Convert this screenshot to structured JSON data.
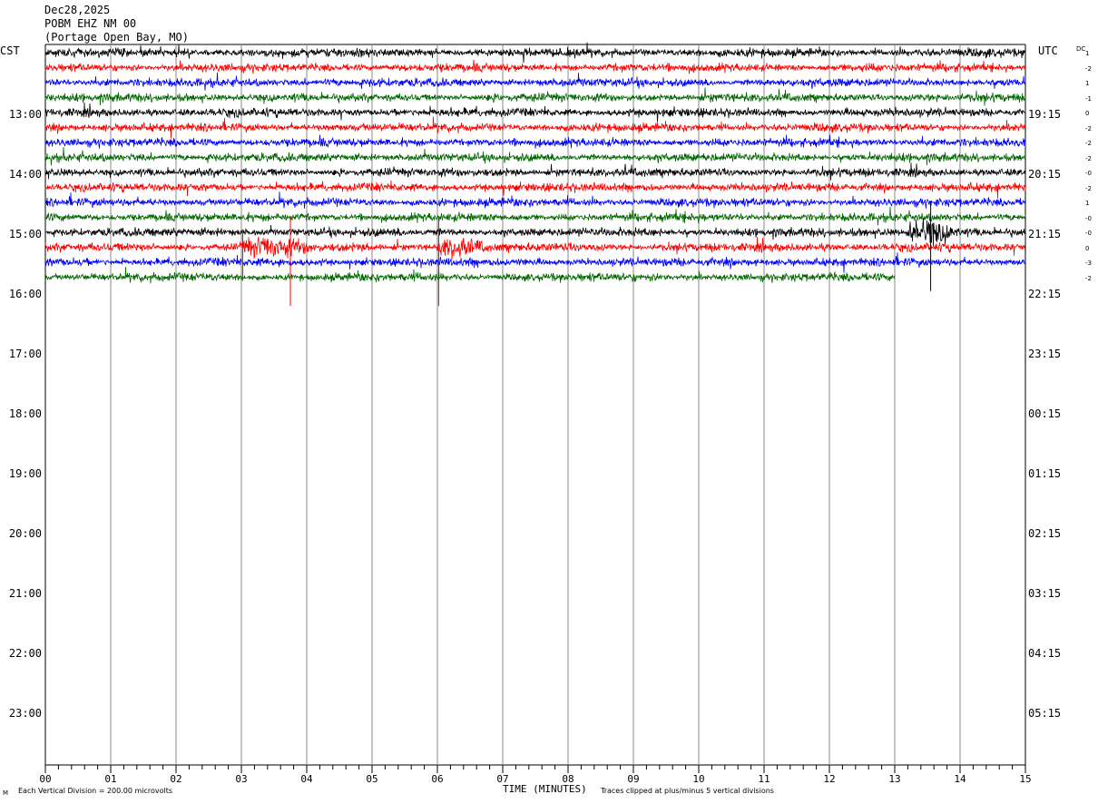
{
  "header": {
    "date": "Dec28,2025",
    "station": "POBM EHZ NM 00",
    "location": "(Portage Open Bay, MO)"
  },
  "corners": {
    "left_tz": "CST",
    "right_tz": "UTC",
    "dc_label": "DC"
  },
  "chart_data": {
    "type": "line",
    "title": "POBM EHZ NM 00",
    "xlabel": "TIME (MINUTES)",
    "xlim": [
      0,
      15
    ],
    "x_ticks": [
      "00",
      "01",
      "02",
      "03",
      "04",
      "05",
      "06",
      "07",
      "08",
      "09",
      "10",
      "11",
      "12",
      "13",
      "14",
      "15"
    ],
    "left_hour_labels": [
      "13:00",
      "14:00",
      "15:00",
      "16:00",
      "17:00",
      "18:00",
      "19:00",
      "20:00",
      "21:00",
      "22:00",
      "23:00"
    ],
    "right_hour_labels": [
      "19:15",
      "20:15",
      "21:15",
      "22:15",
      "23:15",
      "00:15",
      "01:15",
      "02:15",
      "03:15",
      "04:15",
      "05:15"
    ],
    "dc_offsets": [
      "1",
      "-2",
      "1",
      "-1",
      "0",
      "-2",
      "-2",
      "-2",
      "-0",
      "-2",
      "1",
      "-0",
      "-0",
      "0",
      "-3",
      "-2"
    ],
    "trace_colors": [
      "#000000",
      "#ff0000",
      "#0000ff",
      "#006600"
    ],
    "rows_total": 48,
    "traces_recorded": 16,
    "last_trace_end_minute": 13.0,
    "events": [
      {
        "trace": 13,
        "start_min": 3.0,
        "end_min": 4.2,
        "amp": 4.5
      },
      {
        "trace": 13,
        "start_min": 6.0,
        "end_min": 6.8,
        "amp": 4.5
      },
      {
        "trace": 12,
        "start_min": 13.2,
        "end_min": 14.0,
        "amp": 5.0
      },
      {
        "trace": 4,
        "start_min": 0.0,
        "end_min": 0.1,
        "amp": 2.0
      }
    ],
    "spikes": [
      {
        "trace": 13,
        "minute": 3.75,
        "depth": 7
      },
      {
        "trace": 13,
        "minute": 6.02,
        "depth": 7
      },
      {
        "trace": 13,
        "minute": 3.02,
        "depth": 4
      },
      {
        "trace": 12,
        "minute": 13.55,
        "depth": 7
      }
    ]
  },
  "footer": {
    "vertical_division": "Each Vertical Division =  200.00 microvolts",
    "time_label": "TIME (MINUTES)",
    "clip_note": "Traces clipped at plus/minus 5 vertical divisions",
    "logo_mark": "M"
  }
}
